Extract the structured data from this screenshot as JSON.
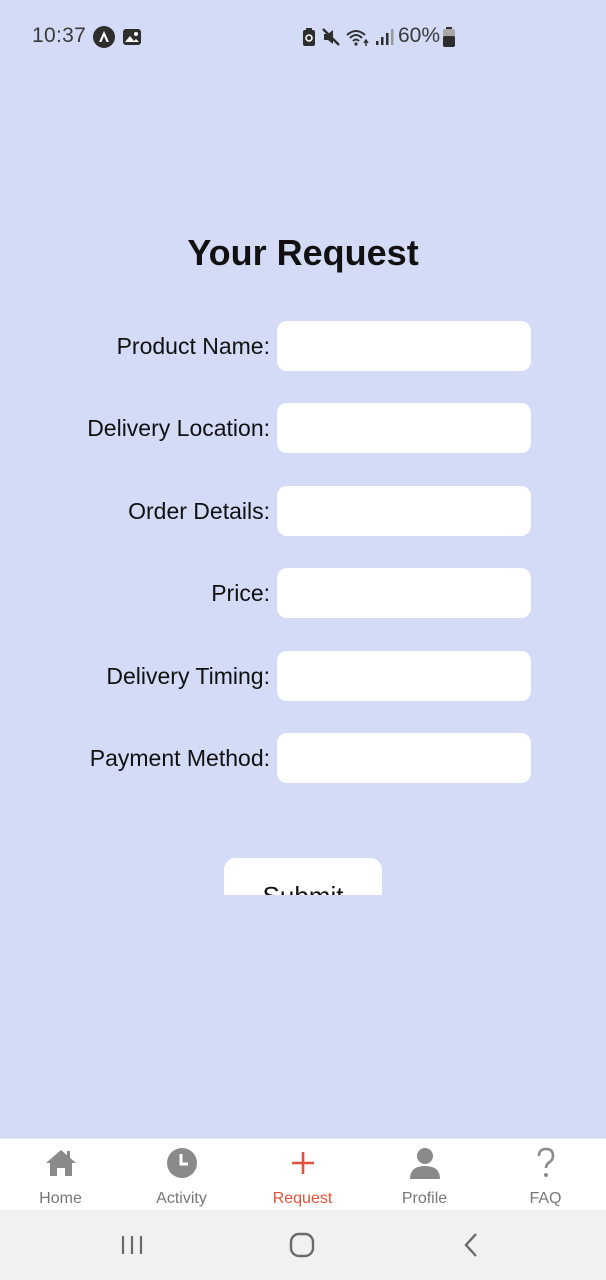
{
  "status_bar": {
    "time": "10:37",
    "battery_percent": "60%",
    "icons": [
      "app-icon",
      "image-icon",
      "battery-saver-icon",
      "mute-icon",
      "wifi-icon",
      "signal-icon",
      "battery-icon"
    ]
  },
  "page": {
    "title": "Your Request"
  },
  "form": {
    "fields": [
      {
        "label": "Product Name:",
        "value": "",
        "placeholder": ""
      },
      {
        "label": "Delivery Location:",
        "value": "",
        "placeholder": ""
      },
      {
        "label": "Order Details:",
        "value": "",
        "placeholder": ""
      },
      {
        "label": "Price:",
        "value": "",
        "placeholder": ""
      },
      {
        "label": "Delivery Timing:",
        "value": "",
        "placeholder": ""
      },
      {
        "label": "Payment Method:",
        "value": "",
        "placeholder": ""
      }
    ],
    "submit_label": "Submit"
  },
  "tab_bar": {
    "active": "Request",
    "tabs": [
      {
        "label": "Home",
        "icon": "home-icon"
      },
      {
        "label": "Activity",
        "icon": "clock-icon"
      },
      {
        "label": "Request",
        "icon": "plus-icon"
      },
      {
        "label": "Profile",
        "icon": "person-icon"
      },
      {
        "label": "FAQ",
        "icon": "question-icon"
      }
    ]
  },
  "colors": {
    "background": "#d4dbf7",
    "accent": "#e2513a",
    "tab_inactive": "#777777"
  }
}
